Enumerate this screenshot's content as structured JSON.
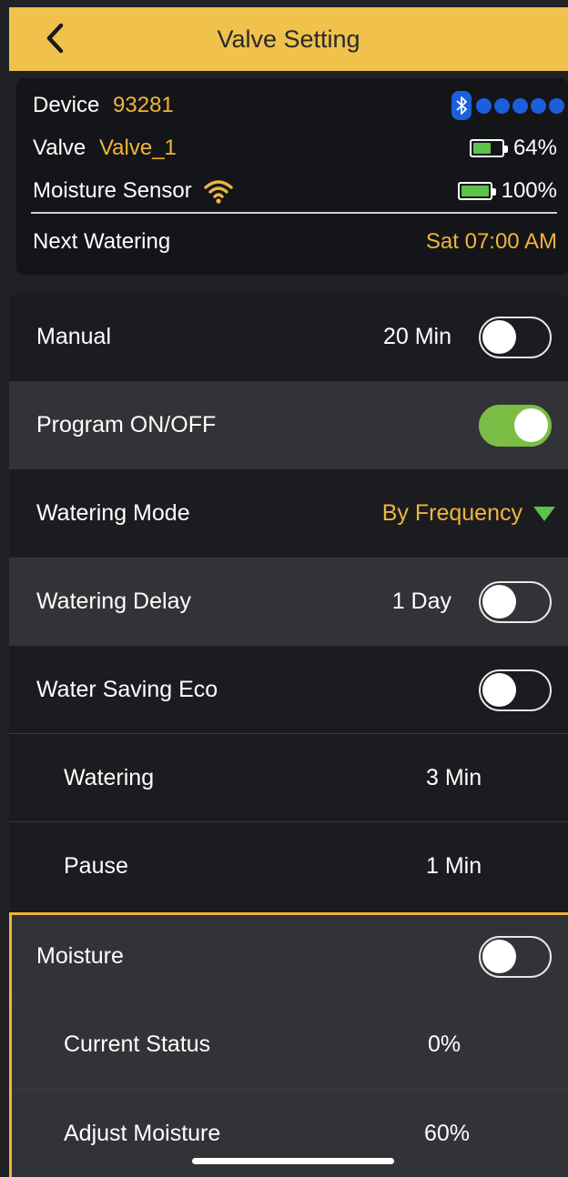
{
  "header": {
    "title": "Valve Setting"
  },
  "device_info": {
    "device_label": "Device",
    "device_value": "93281",
    "valve_label": "Valve",
    "valve_value": "Valve_1",
    "valve_battery": "64%",
    "valve_battery_level": 0.64,
    "sensor_label": "Moisture Sensor",
    "sensor_battery": "100%",
    "sensor_battery_level": 1.0,
    "next_watering_label": "Next Watering",
    "next_watering_value": "Sat 07:00 AM",
    "bluetooth_signal_dots": 5
  },
  "settings": {
    "manual": {
      "label": "Manual",
      "value": "20 Min",
      "enabled": false
    },
    "program": {
      "label": "Program ON/OFF",
      "enabled": true
    },
    "watering_mode": {
      "label": "Watering Mode",
      "value": "By Frequency"
    },
    "watering_delay": {
      "label": "Watering Delay",
      "value": "1 Day",
      "enabled": false
    },
    "water_saving_eco": {
      "label": "Water Saving Eco",
      "enabled": false,
      "watering_label": "Watering",
      "watering_value": "3 Min",
      "pause_label": "Pause",
      "pause_value": "1 Min"
    },
    "moisture": {
      "label": "Moisture",
      "enabled": false,
      "current_status_label": "Current Status",
      "current_status_value": "0%",
      "adjust_label": "Adjust Moisture",
      "adjust_value": "60%"
    }
  },
  "colors": {
    "header_bg": "#f0c14b",
    "accent": "#f0b43c",
    "toggle_on": "#7cbd45",
    "bluetooth": "#1c5fdc",
    "battery": "#5cc24a"
  },
  "icons": [
    "back-chevron-icon",
    "bluetooth-icon",
    "wifi-icon",
    "battery-icon",
    "dropdown-triangle-icon"
  ]
}
